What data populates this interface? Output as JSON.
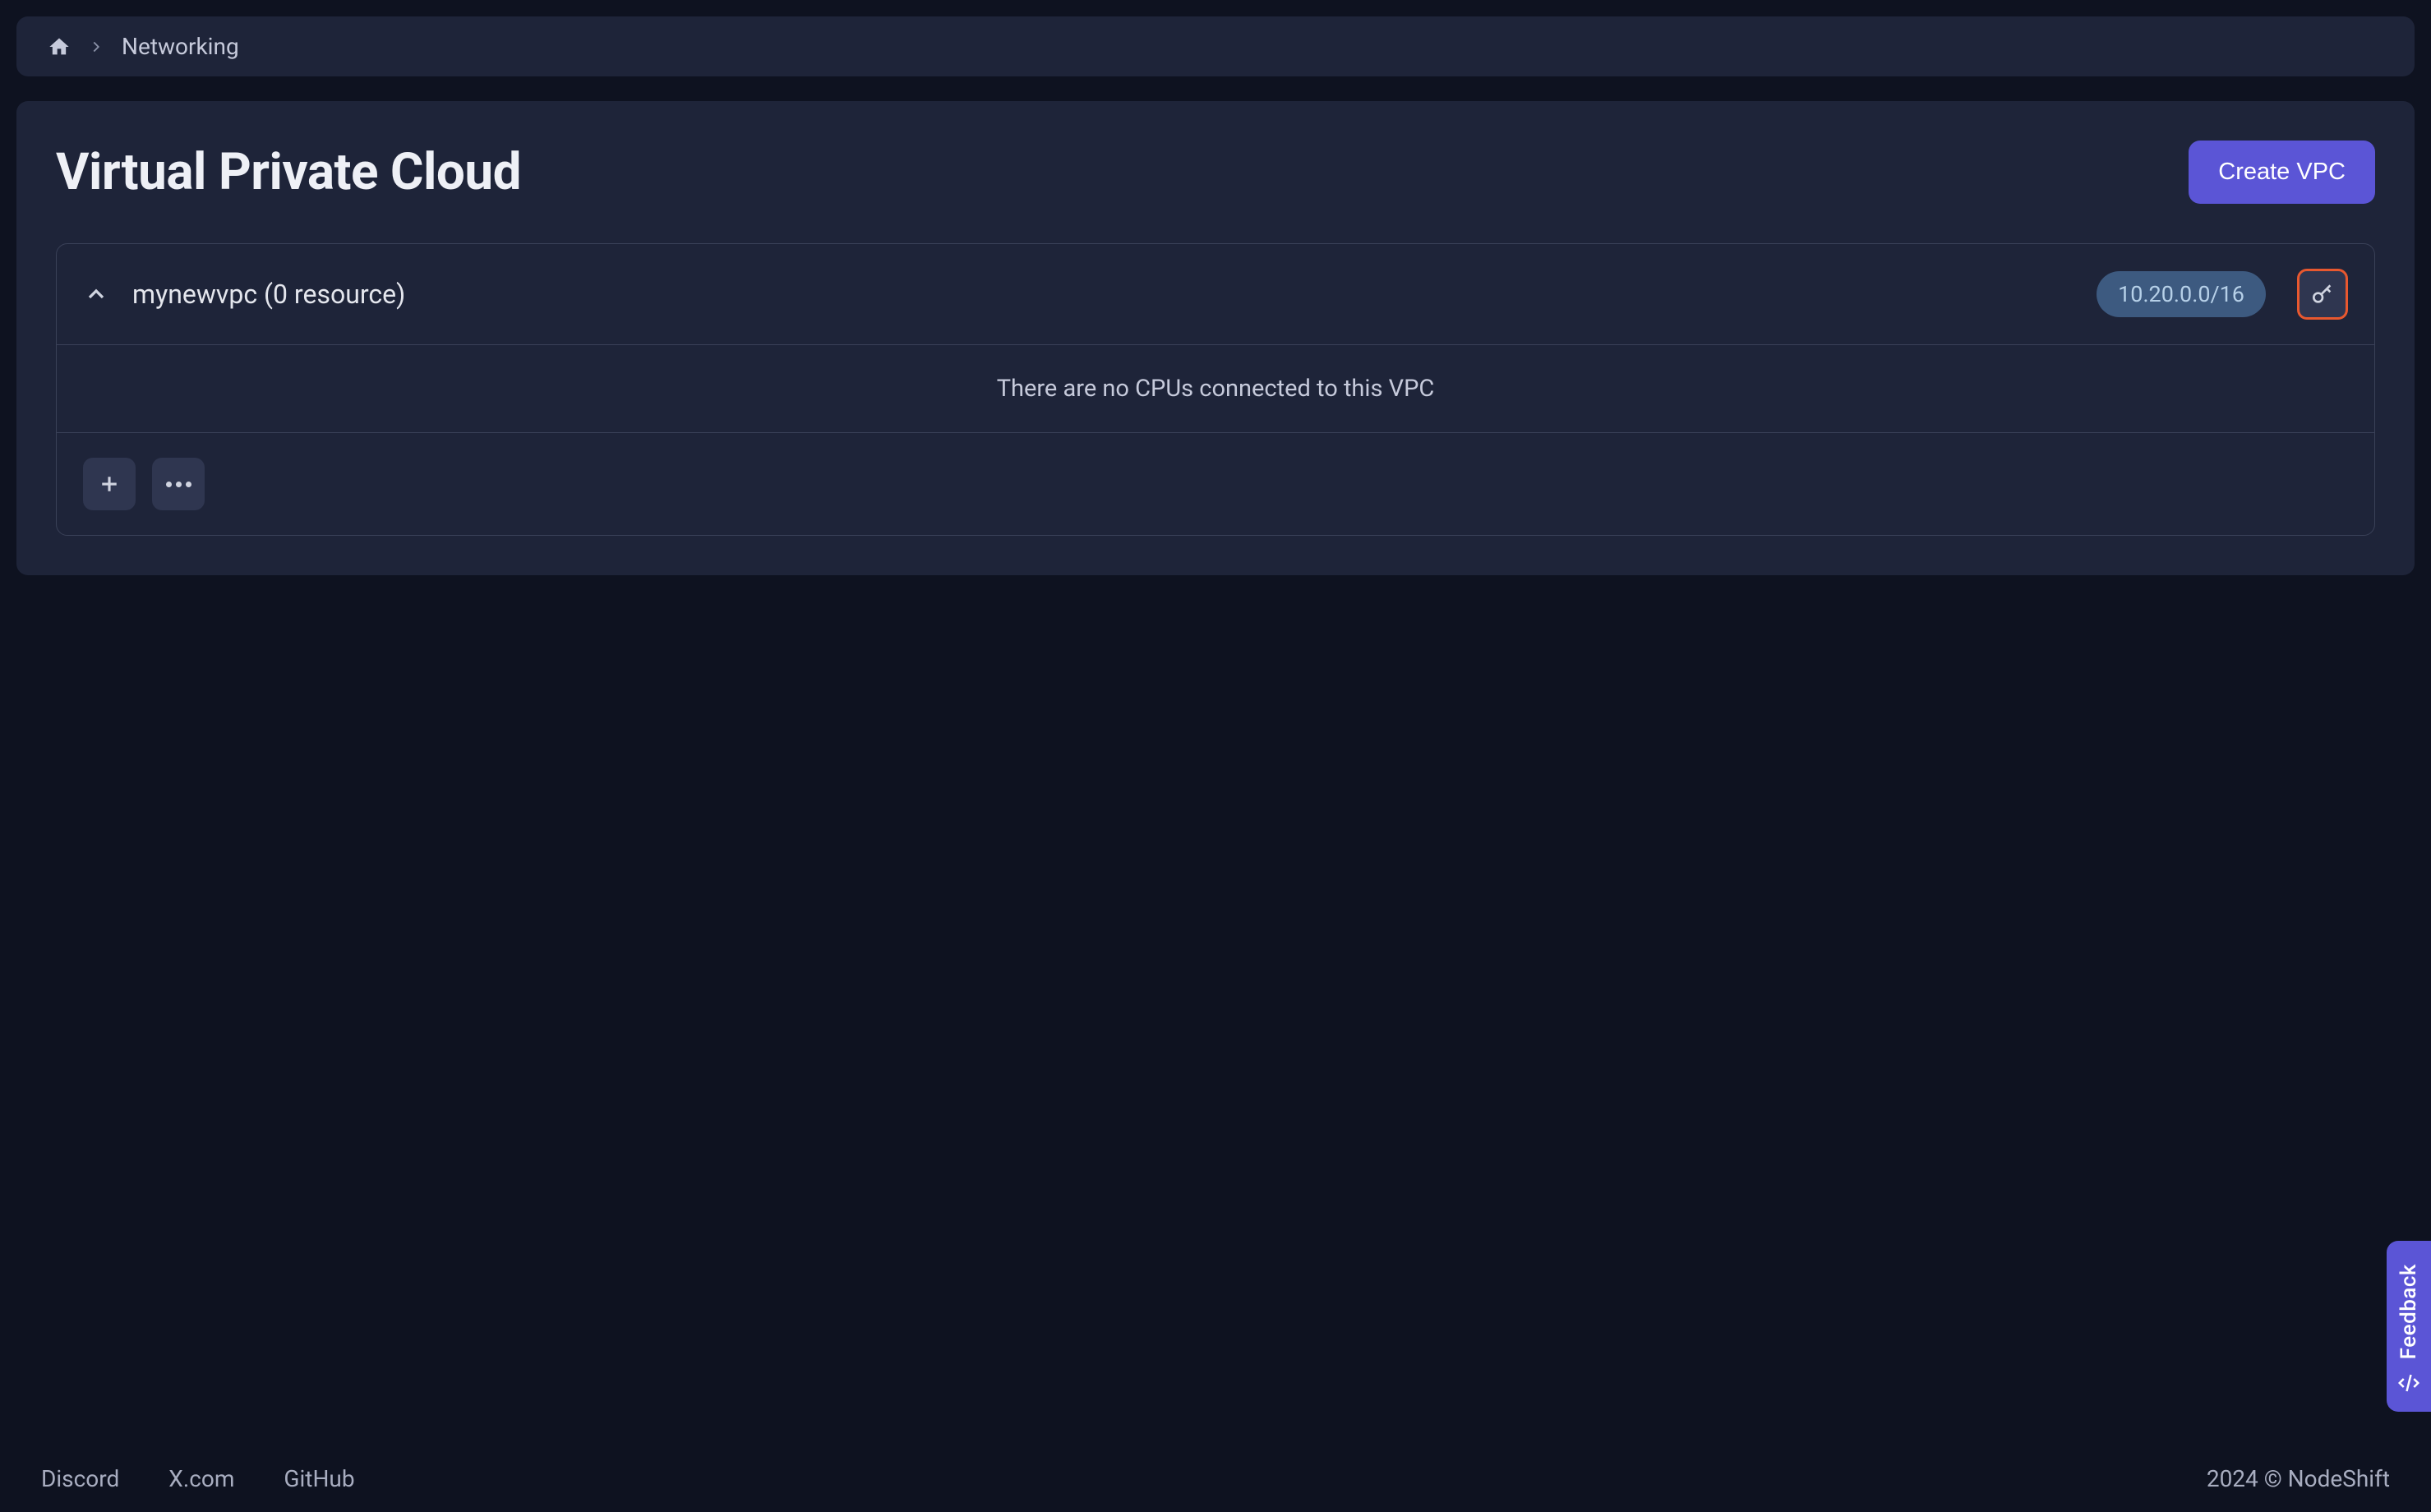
{
  "breadcrumb": {
    "current": "Networking"
  },
  "page": {
    "title": "Virtual Private Cloud",
    "create_button": "Create VPC"
  },
  "vpc": {
    "name": "mynewvpc (0 resource)",
    "cidr": "10.20.0.0/16",
    "empty_message": "There are no CPUs connected to this VPC"
  },
  "footer": {
    "links": {
      "discord": "Discord",
      "x": "X.com",
      "github": "GitHub"
    },
    "copyright": "2024 © NodeShift"
  },
  "feedback": {
    "label": "Feedback"
  }
}
